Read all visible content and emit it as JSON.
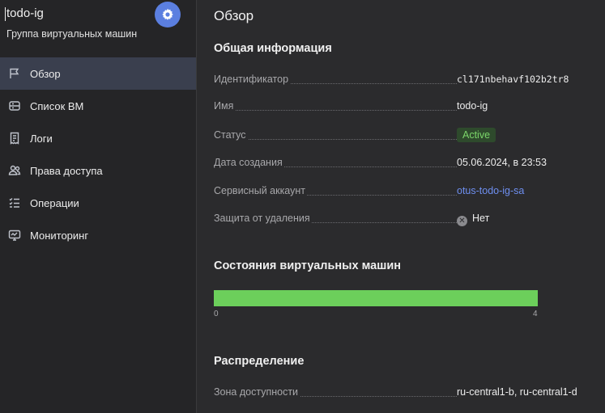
{
  "sidebar": {
    "title": "todo-ig",
    "subtitle": "Группа виртуальных машин",
    "settings_icon": "gear-icon",
    "accent": "#5b7fe0",
    "items": [
      {
        "label": "Обзор",
        "icon": "flag-icon",
        "active": true
      },
      {
        "label": "Список ВМ",
        "icon": "server-list-icon",
        "active": false
      },
      {
        "label": "Логи",
        "icon": "receipt-icon",
        "active": false
      },
      {
        "label": "Права доступа",
        "icon": "users-icon",
        "active": false
      },
      {
        "label": "Операции",
        "icon": "list-check-icon",
        "active": false
      },
      {
        "label": "Мониторинг",
        "icon": "monitor-chart-icon",
        "active": false
      }
    ]
  },
  "main": {
    "page_title": "Обзор",
    "general": {
      "title": "Общая информация",
      "rows": [
        {
          "label": "Идентификатор",
          "value": "cl171nbehavf102b2tr8"
        },
        {
          "label": "Имя",
          "value": "todo-ig"
        },
        {
          "label": "Статус",
          "value": "Active"
        },
        {
          "label": "Дата создания",
          "value": "05.06.2024, в 23:53"
        },
        {
          "label": "Сервисный аккаунт",
          "value": "otus-todo-ig-sa"
        },
        {
          "label": "Защита от удаления",
          "value": "Нет"
        }
      ]
    },
    "vm_states": {
      "title": "Состояния виртуальных машин",
      "min_label": "0",
      "max_label": "4",
      "running": 4,
      "total": 4,
      "bar_color": "#6ccf5b"
    },
    "distribution": {
      "title": "Распределение",
      "zone_label": "Зона доступности",
      "zone_value": "ru-central1-b, ru-central1-d"
    }
  }
}
